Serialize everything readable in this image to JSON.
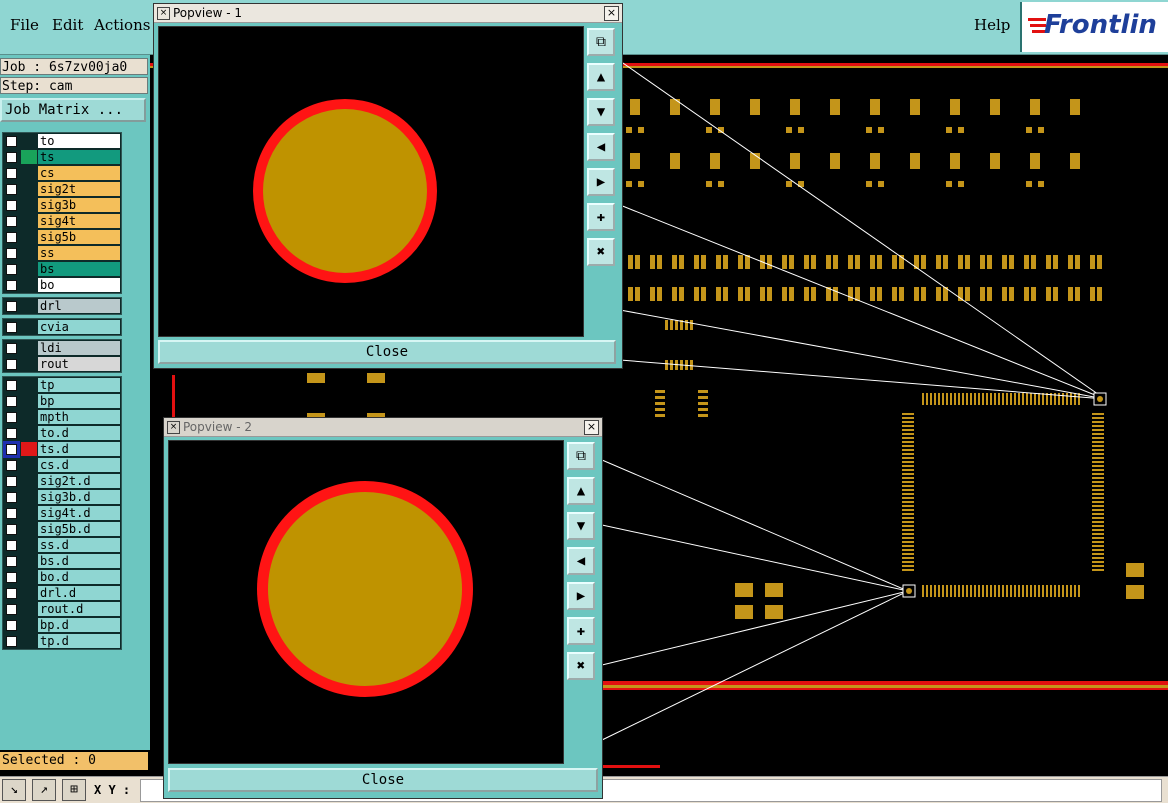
{
  "menu": {
    "file": "File",
    "edit": "Edit",
    "actions": "Actions",
    "help": "Help"
  },
  "logo": {
    "text": "Frontlin"
  },
  "job": {
    "job_line": "Job : 6s7zv00ja0",
    "step_line": "Step: cam",
    "matrix_button": "Job Matrix ..."
  },
  "layers": {
    "group1": [
      {
        "name": "to",
        "bg": "#ffffff"
      },
      {
        "name": "ts",
        "bg": "#129a7e",
        "swatch": "#19a35a"
      },
      {
        "name": "cs",
        "bg": "#f4bf5a"
      },
      {
        "name": "sig2t",
        "bg": "#f4bf5a"
      },
      {
        "name": "sig3b",
        "bg": "#f4bf5a"
      },
      {
        "name": "sig4t",
        "bg": "#f4bf5a"
      },
      {
        "name": "sig5b",
        "bg": "#f4bf5a"
      },
      {
        "name": "ss",
        "bg": "#f4bf5a"
      },
      {
        "name": "bs",
        "bg": "#129a7e"
      },
      {
        "name": "bo",
        "bg": "#ffffff"
      }
    ],
    "group2": [
      {
        "name": "drl",
        "bg": "#b9c9cc"
      }
    ],
    "group3": [
      {
        "name": "cvia",
        "bg": "#8fd6d2"
      }
    ],
    "group4": [
      {
        "name": "ldi",
        "bg": "#b9c9cc"
      },
      {
        "name": "rout",
        "bg": "#d7d7d7"
      }
    ],
    "group5": [
      {
        "name": "tp",
        "bg": "#8fd6d2"
      },
      {
        "name": "bp",
        "bg": "#8fd6d2"
      },
      {
        "name": "mpth",
        "bg": "#8fd6d2"
      },
      {
        "name": "to.d",
        "bg": "#8fd6d2"
      },
      {
        "name": "ts.d",
        "bg": "#8fd6d2",
        "swatch": "#e01818",
        "active": true
      },
      {
        "name": "cs.d",
        "bg": "#8fd6d2"
      },
      {
        "name": "sig2t.d",
        "bg": "#8fd6d2"
      },
      {
        "name": "sig3b.d",
        "bg": "#8fd6d2"
      },
      {
        "name": "sig4t.d",
        "bg": "#8fd6d2"
      },
      {
        "name": "sig5b.d",
        "bg": "#8fd6d2"
      },
      {
        "name": "ss.d",
        "bg": "#8fd6d2"
      },
      {
        "name": "bs.d",
        "bg": "#8fd6d2"
      },
      {
        "name": "bo.d",
        "bg": "#8fd6d2"
      },
      {
        "name": "drl.d",
        "bg": "#8fd6d2"
      },
      {
        "name": "rout.d",
        "bg": "#8fd6d2"
      },
      {
        "name": "bp.d",
        "bg": "#8fd6d2"
      },
      {
        "name": "tp.d",
        "bg": "#8fd6d2"
      }
    ]
  },
  "status": {
    "selected": "Selected : 0",
    "xy_label": "X Y :"
  },
  "popup1": {
    "title": "Popview - 1",
    "close": "Close"
  },
  "popup2": {
    "title": "Popview - 2",
    "close": "Close"
  },
  "colors": {
    "pad_fill": "#bf9300",
    "pad_ring": "#ff1414",
    "copper": "#c4951a",
    "panel": "#6cc6c0"
  }
}
